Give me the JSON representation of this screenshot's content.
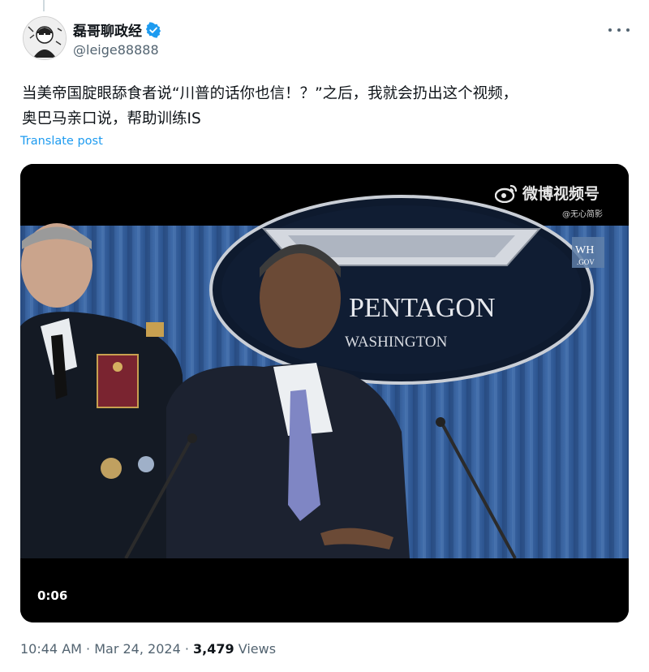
{
  "author": {
    "name": "磊哥聊政经",
    "handle": "@leige88888",
    "verified_color": "#1d9bf0"
  },
  "tweet": {
    "text": "当美帝国腚眼舔食者说“川普的话你也信！？”之后，我就会扔出这个视频，\n奥巴马亲口说，帮助训练IS",
    "translate_label": "Translate post"
  },
  "video": {
    "current_time": "0:06",
    "watermark_title": "微博视频号",
    "watermark_sub": "@无心简影",
    "podium_text_1": "PENTAGON",
    "podium_text_2": "WASHINGTON",
    "badge_text_1": "WH",
    "badge_text_2": ".GOV"
  },
  "meta": {
    "time": "10:44 AM",
    "separator": " · ",
    "date": "Mar 24, 2024",
    "views_count": "3,479",
    "views_label": "Views"
  },
  "icons": {
    "more": "more-horizontal-icon",
    "verified": "verified-badge-icon",
    "weibo": "weibo-logo-icon"
  }
}
